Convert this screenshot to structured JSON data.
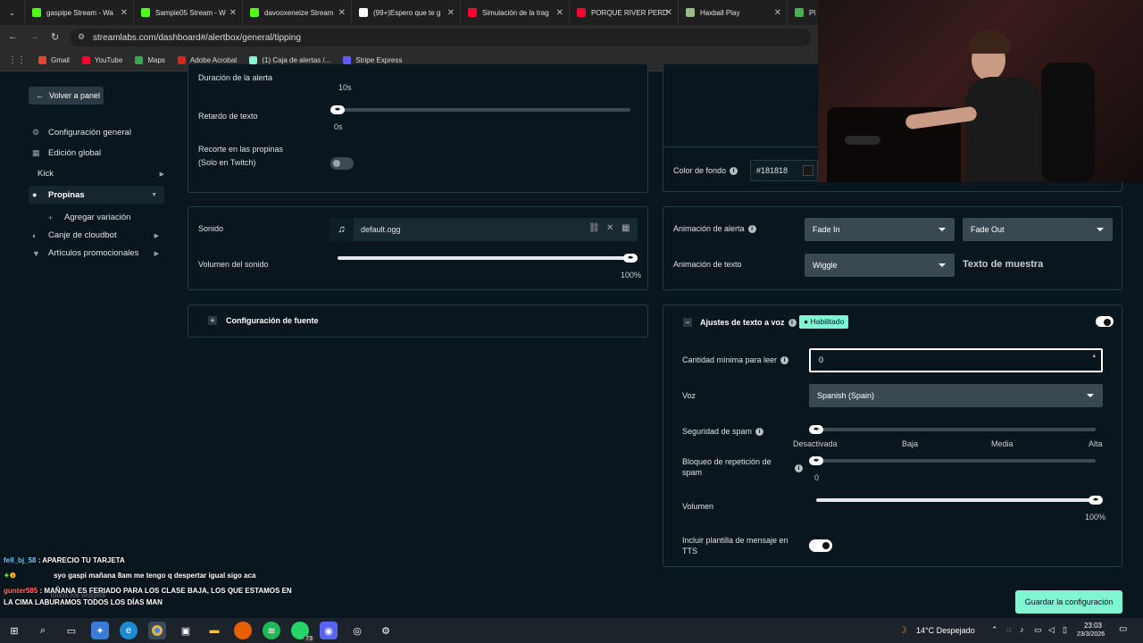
{
  "browser": {
    "tabs": [
      {
        "label": "gaspipe Stream - Wa",
        "color": "#53fc18"
      },
      {
        "label": "Sampie05 Stream - W",
        "color": "#53fc18"
      },
      {
        "label": "davooxeneize Stream",
        "color": "#53fc18"
      },
      {
        "label": "(99+)Espero que te g",
        "color": "#ffffff"
      },
      {
        "label": "Simulación de la trag",
        "color": "#ff0033"
      },
      {
        "label": "PORQUE RIVER PERD",
        "color": "#ff0033"
      },
      {
        "label": "Haxball Play",
        "color": "#9bb98a"
      },
      {
        "label": "Pl",
        "color": "#4caf50"
      }
    ],
    "url": "streamlabs.com/dashboard#/alertbox/general/tipping",
    "bookmarks": [
      {
        "label": "Gmail",
        "color": "#ea4335"
      },
      {
        "label": "YouTube",
        "color": "#ff0033"
      },
      {
        "label": "Maps",
        "color": "#34a853"
      },
      {
        "label": "Adobe Acrobat",
        "color": "#d9261c"
      },
      {
        "label": "(1) Caja de alertas /...",
        "color": "#80f5d2"
      },
      {
        "label": "Stripe Express",
        "color": "#635bff"
      }
    ]
  },
  "sidebar": {
    "back_label": "Volver a panel",
    "items": [
      {
        "label": "Configuración general",
        "icon": "⚙"
      },
      {
        "label": "Edición global",
        "icon": "▦"
      },
      {
        "label": "Kick",
        "icon": ""
      },
      {
        "label": "Propinas",
        "icon": "●"
      },
      {
        "label": "Agregar variación",
        "icon": "+"
      },
      {
        "label": "Canje de cloudbot",
        "icon": "◐"
      },
      {
        "label": "Artículos promocionales",
        "icon": "▼"
      }
    ]
  },
  "alert_settings": {
    "duration_label": "Duración de la alerta",
    "duration_value": "10s",
    "text_delay_label": "Retardo de texto",
    "text_delay_value": "0s",
    "crop_label_1": "Recorte en las propinas",
    "crop_label_2": "(Solo en Twitch)",
    "crop_enabled": false
  },
  "sound": {
    "label": "Sonido",
    "file": "default.ogg",
    "volume_label": "Volumen del sonido",
    "volume_value": "100%",
    "volume_fraction": 1.0
  },
  "font_config": {
    "label": "Configuración de fuente"
  },
  "background": {
    "label": "Color de fondo",
    "value": "#181818",
    "color": "#181818"
  },
  "animation": {
    "alert_label": "Animación de alerta",
    "alert_in": "Fade In",
    "alert_out": "Fade Out",
    "text_label": "Animación de texto",
    "text_anim": "Wiggle",
    "sample_text": "Texto de muestra"
  },
  "tts": {
    "title": "Ajustes de texto a voz",
    "badge": "Habilitado",
    "enabled": true,
    "min_amount_label": "Cantidad mínima para leer",
    "min_amount_value": "0",
    "voice_label": "Voz",
    "voice_value": "Spanish (Spain)",
    "spam_label": "Seguridad de spam",
    "spam_ticks": [
      "Desactivada",
      "Baja",
      "Media",
      "Alta"
    ],
    "spam_level": 0,
    "repeat_label_1": "Bloqueo de repetición de",
    "repeat_label_2": "spam",
    "repeat_value": "0",
    "volume_label": "Volumen",
    "volume_value": "100%",
    "volume_fraction": 1.0,
    "template_label_1": "Incluir plantilla de mensaje en",
    "template_label_2": "TTS",
    "template_enabled": true
  },
  "save_label": "Guardar la configuración",
  "chat": [
    {
      "user": "fell_bj_58",
      "msg": "APARECIO TU TARJETA",
      "user_color": "#5fd3ff"
    },
    {
      "user": "",
      "msg": "syo gaspi mañana 8am me tengo q despertar igual sigo aca",
      "user_color": "#ff4d4d"
    },
    {
      "user": "gunter585",
      "msg": "MAÑANA ES FERIADO PARA LOS CLASE BAJA, LOS QUE ESTAMOS EN",
      "user_color": "#ff6b6b"
    },
    {
      "user": "",
      "msg": "LA CIMA LABURAMOS TODOS LOS DÍAS MAN",
      "user_color": "#ffffff"
    }
  ],
  "widgets_label": "Todos los widgets",
  "taskbar": {
    "weather": "14°C  Despejado",
    "time": "23:03",
    "date": "23/3/2026",
    "badge": "73"
  }
}
